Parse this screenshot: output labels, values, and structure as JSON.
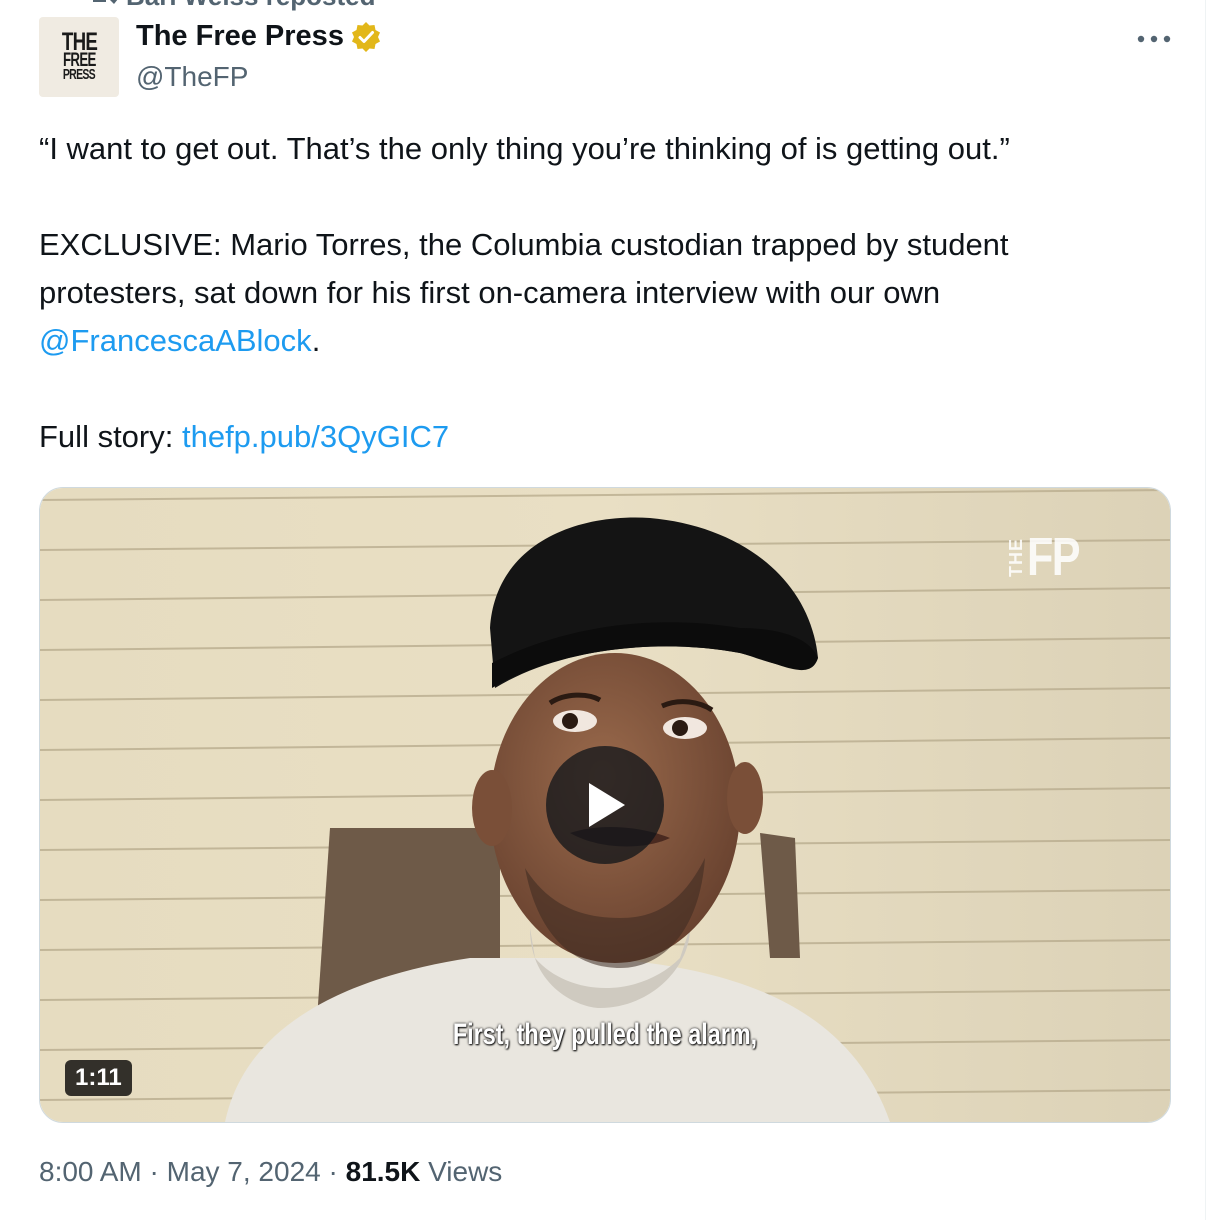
{
  "repost": {
    "text": "Bari Weiss reposted"
  },
  "author": {
    "avatar_lines": [
      "THE",
      "FREE",
      "PRESS"
    ],
    "display_name": "The Free Press",
    "handle": "@TheFP",
    "verified_badge": "gold-verified-badge-icon"
  },
  "more_icon": "more-horizontal-icon",
  "tweet": {
    "quote": "“I want to get out. That’s the only thing you’re thinking of is getting out.”",
    "body_prefix": "EXCLUSIVE: Mario Torres, the Columbia custodian trapped by student protesters, sat down for his first on-camera interview with our own ",
    "mention": "@FrancescaABlock",
    "body_suffix": ".",
    "story_label": "Full story: ",
    "story_link": "thefp.pub/3QyGIC7"
  },
  "media": {
    "caption": "First, they pulled the alarm,",
    "watermark_small": "THE",
    "watermark_large": "FP",
    "duration": "1:11",
    "play_icon": "play-icon"
  },
  "meta": {
    "time": "8:00 AM",
    "separator": " · ",
    "date": "May 7, 2024",
    "views_count": "81.5K",
    "views_label": " Views"
  },
  "colors": {
    "link": "#1d9bf0",
    "secondary_text": "#536471",
    "verified_gold": "#e2b719"
  }
}
